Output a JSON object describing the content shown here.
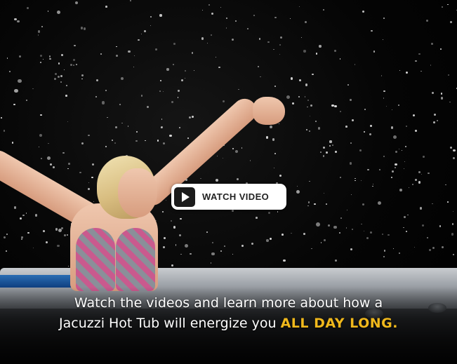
{
  "hero": {
    "watch_button_label": "WATCH VIDEO",
    "caption_line1": "Watch the videos and learn more about how a",
    "caption_line2_prefix": "Jacuzzi Hot Tub will energize you ",
    "caption_highlight": "ALL DAY LONG",
    "caption_suffix": ".",
    "play_icon": "play-icon"
  },
  "colors": {
    "background": "#000000",
    "button_bg": "#ffffff",
    "button_text": "#222222",
    "caption_text": "#ffffff",
    "highlight": "#f0b81c"
  }
}
